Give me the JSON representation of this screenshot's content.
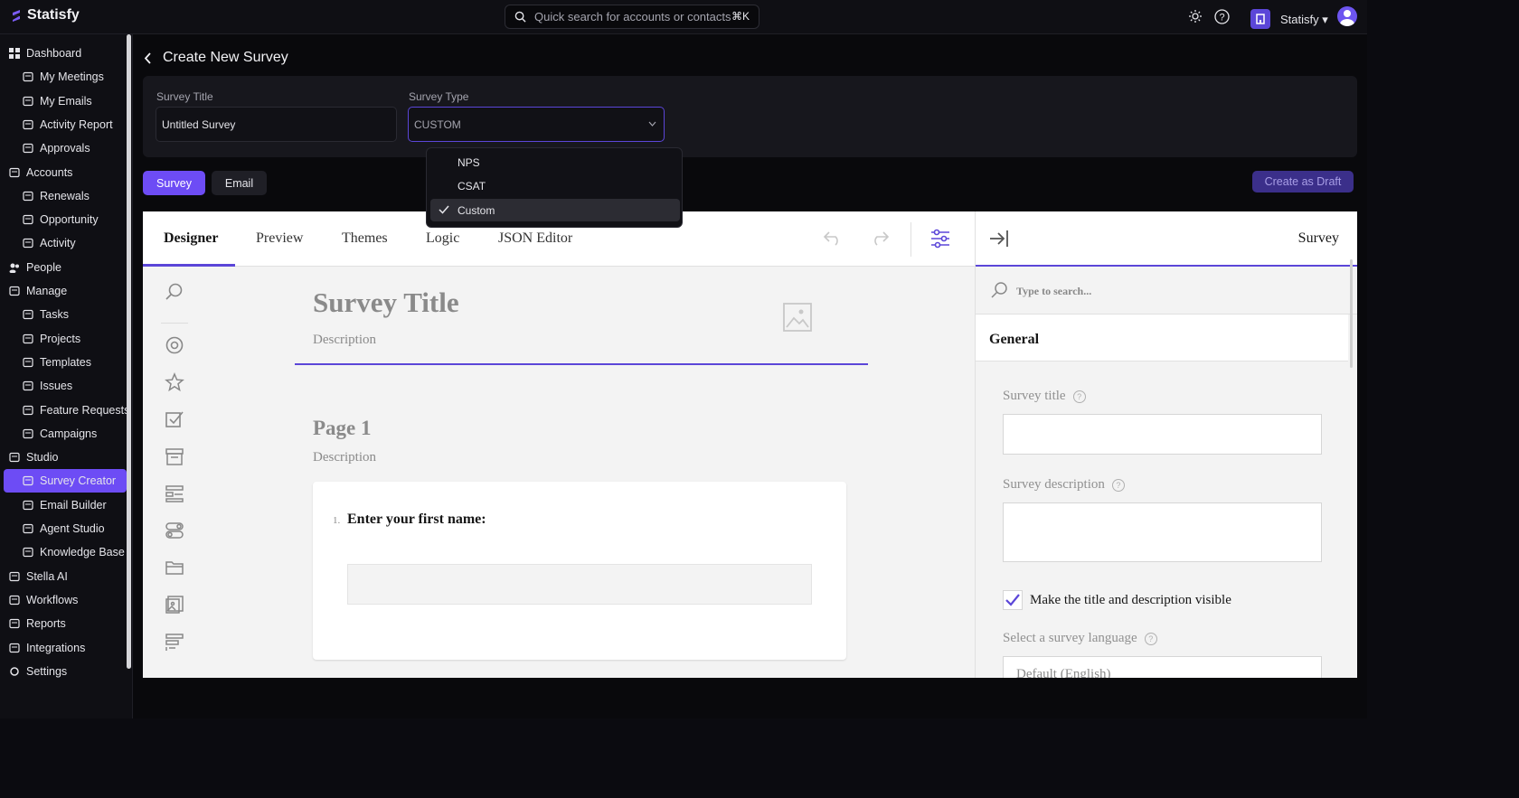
{
  "app": {
    "name": "Statisfy"
  },
  "topbar": {
    "search_placeholder": "Quick search for accounts or contacts",
    "search_shortcut": "⌘K",
    "org_name": "Statisfy",
    "icons": [
      "sun-icon",
      "help-icon",
      "org-icon",
      "avatar"
    ]
  },
  "sidebar": {
    "items": [
      {
        "label": "Dashboard",
        "icon": "dashboard-icon",
        "level": "top"
      },
      {
        "label": "My Meetings",
        "icon": "calendar-icon",
        "level": "sub"
      },
      {
        "label": "My Emails",
        "icon": "mail-icon",
        "level": "sub"
      },
      {
        "label": "Activity Report",
        "icon": "clipboard-icon",
        "level": "sub"
      },
      {
        "label": "Approvals",
        "icon": "check-circle-icon",
        "level": "sub"
      },
      {
        "label": "Accounts",
        "icon": "accounts-icon",
        "level": "top"
      },
      {
        "label": "Renewals",
        "icon": "renew-icon",
        "level": "sub"
      },
      {
        "label": "Opportunity",
        "icon": "trend-icon",
        "level": "sub"
      },
      {
        "label": "Activity",
        "icon": "clipboard-icon",
        "level": "sub"
      },
      {
        "label": "People",
        "icon": "people-icon",
        "level": "top"
      },
      {
        "label": "Manage",
        "icon": "manage-icon",
        "level": "top"
      },
      {
        "label": "Tasks",
        "icon": "list-icon",
        "level": "sub"
      },
      {
        "label": "Projects",
        "icon": "folder-icon",
        "level": "sub"
      },
      {
        "label": "Templates",
        "icon": "template-icon",
        "level": "sub"
      },
      {
        "label": "Issues",
        "icon": "alert-icon",
        "level": "sub"
      },
      {
        "label": "Feature Requests",
        "icon": "feature-icon",
        "level": "sub"
      },
      {
        "label": "Campaigns",
        "icon": "mail-icon",
        "level": "sub"
      },
      {
        "label": "Studio",
        "icon": "studio-icon",
        "level": "top"
      },
      {
        "label": "Survey Creator",
        "icon": "survey-icon",
        "level": "sub",
        "active": true
      },
      {
        "label": "Email Builder",
        "icon": "mail-icon",
        "level": "sub"
      },
      {
        "label": "Agent Studio",
        "icon": "agent-icon",
        "level": "sub"
      },
      {
        "label": "Knowledge Base",
        "icon": "database-icon",
        "level": "sub"
      },
      {
        "label": "Stella AI",
        "icon": "ai-icon",
        "level": "top"
      },
      {
        "label": "Workflows",
        "icon": "workflow-icon",
        "level": "top"
      },
      {
        "label": "Reports",
        "icon": "chart-icon",
        "level": "top"
      },
      {
        "label": "Integrations",
        "icon": "layers-icon",
        "level": "top"
      },
      {
        "label": "Settings",
        "icon": "gear-icon",
        "level": "top"
      }
    ]
  },
  "page": {
    "title": "Create New Survey",
    "survey_title_label": "Survey Title",
    "survey_title_value": "Untitled Survey",
    "survey_type_label": "Survey Type",
    "survey_type_value": "CUSTOM",
    "type_options": [
      {
        "label": "NPS",
        "selected": false
      },
      {
        "label": "CSAT",
        "selected": false
      },
      {
        "label": "Custom",
        "selected": true
      }
    ],
    "tab_survey": "Survey",
    "tab_email": "Email",
    "create_draft": "Create as Draft"
  },
  "designer": {
    "tabs": [
      "Designer",
      "Preview",
      "Themes",
      "Logic",
      "JSON Editor"
    ],
    "active_tab": "Designer",
    "survey_title": "Survey Title",
    "survey_description": "Description",
    "page_title": "Page 1",
    "page_description": "Description",
    "question_number": "1.",
    "question_text": "Enter your first name:"
  },
  "properties": {
    "header": "Survey",
    "search_placeholder": "Type to search...",
    "section": "General",
    "survey_title_label": "Survey title",
    "survey_description_label": "Survey description",
    "visible_checkbox_label": "Make the title and description visible",
    "language_label": "Select a survey language",
    "language_value": "Default (English)"
  },
  "colors": {
    "accent": "#6d4cf5",
    "accent_dark": "#5b46d8",
    "bg": "#09090c"
  }
}
